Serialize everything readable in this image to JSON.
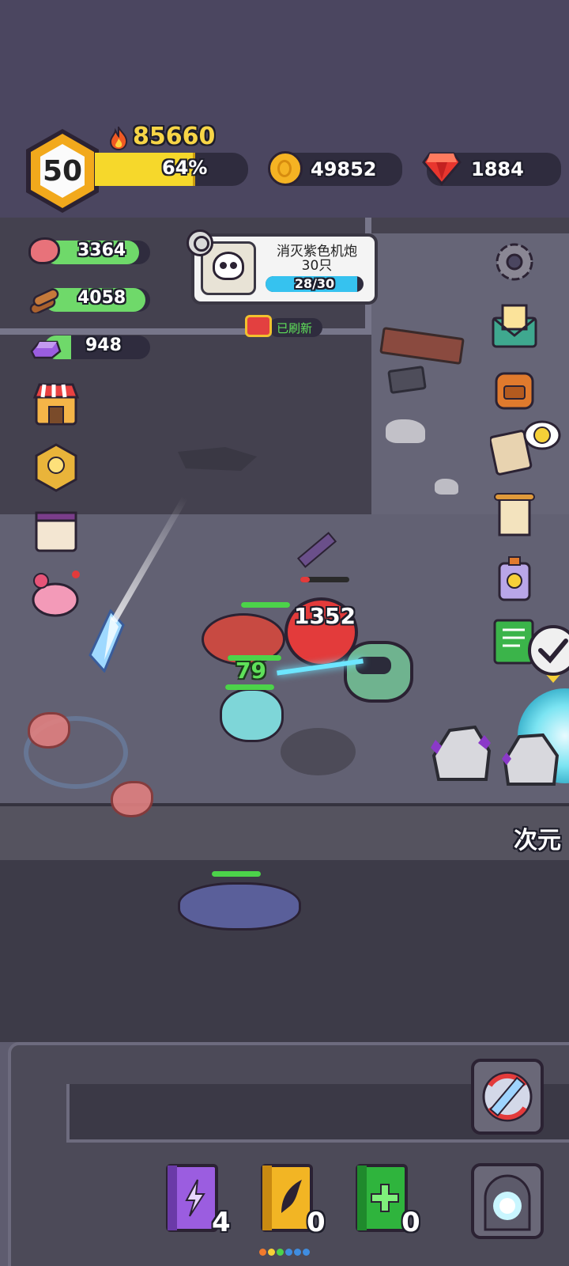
{
  "player": {
    "level": "50",
    "power": "85660",
    "xp_percent_label": "64%",
    "xp_fraction": 0.64
  },
  "currency": {
    "gold": "49852",
    "gems": "1884"
  },
  "resources": {
    "meat": "3364",
    "wood": "4058",
    "crystal": "948"
  },
  "quest": {
    "title_line1": "消灭紫色机炮",
    "title_line2": "30只",
    "progress_label": "28/30",
    "progress_fraction": 0.933,
    "refresh_label": "已刷新"
  },
  "battle": {
    "damage_number": "1352",
    "heal_number": "79",
    "portal_label": "次元"
  },
  "skills": [
    {
      "name": "lightning",
      "count": "4"
    },
    {
      "name": "wing",
      "count": "0"
    },
    {
      "name": "heal",
      "count": "0"
    }
  ],
  "colors": {
    "background": "#4b4660",
    "floor": "#5c5a6e",
    "xp_bar": "#f6d82b",
    "resource_bar": "#6fd96a",
    "quest_bar": "#36c2ef",
    "power_text": "#f7d547"
  }
}
